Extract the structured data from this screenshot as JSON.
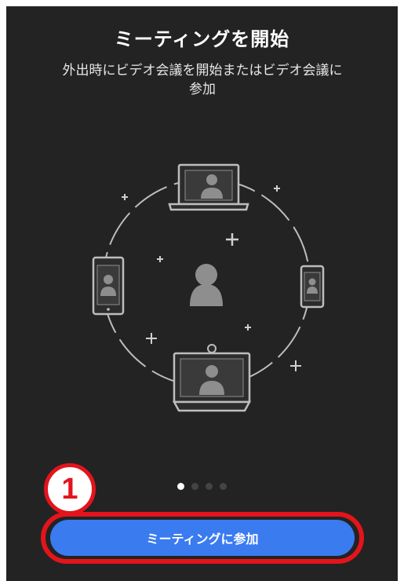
{
  "onboarding": {
    "title": "ミーティングを開始",
    "subtitle": "外出時にビデオ会議を開始またはビデオ会議に参加",
    "illustration": {
      "icons": [
        "laptop-icon",
        "tablet-icon",
        "phone-icon",
        "room-system-icon",
        "user-icon"
      ]
    },
    "pagination": {
      "total": 4,
      "active_index": 0
    },
    "join_button_label": "ミーティングに参加"
  },
  "annotation": {
    "step_number": "1",
    "color": "#e3141c"
  },
  "colors": {
    "background": "#232323",
    "accent": "#3a7bf0",
    "line": "#bdbdbd"
  }
}
